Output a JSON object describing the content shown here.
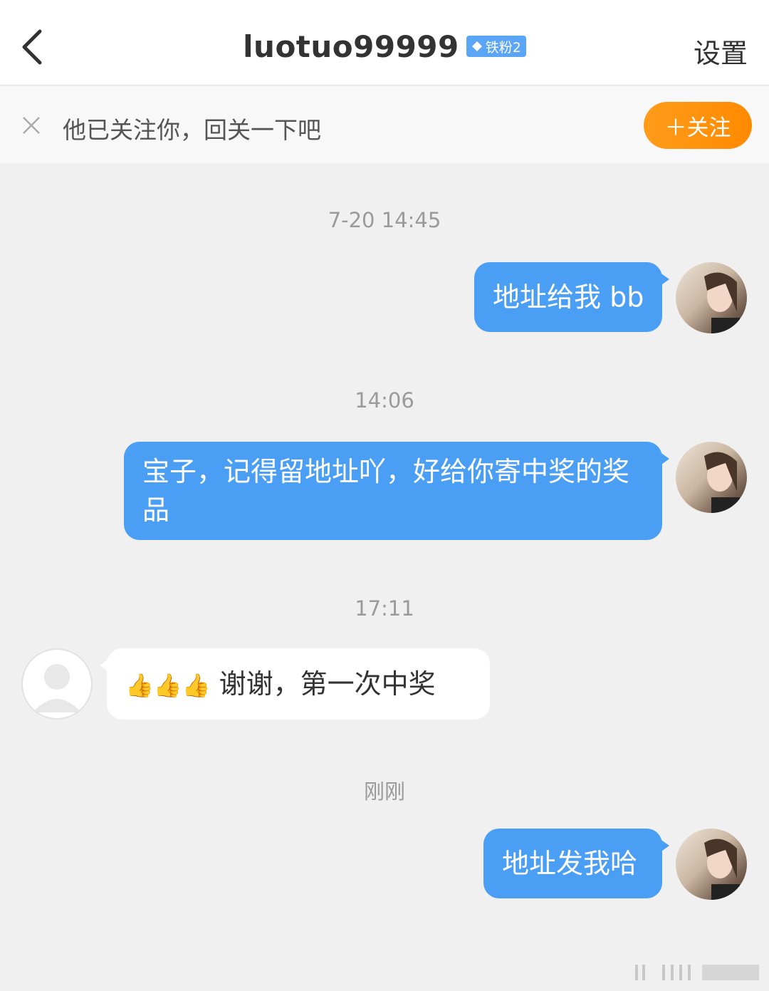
{
  "header": {
    "title": "luotuo99999",
    "badge_label": "铁粉2",
    "settings_label": "设置",
    "back_icon": "chevron-left-icon"
  },
  "follow_bar": {
    "text": "他已关注你，回关一下吧",
    "button_label": "＋关注",
    "colors": {
      "button": "#ff9200",
      "bar": "#f8f8f8"
    }
  },
  "messages": [
    {
      "time": "7-20 14:45",
      "from": "me",
      "text": "地址给我 bb"
    },
    {
      "time": "14:06",
      "from": "me",
      "text": "宝子，记得留地址吖，好给你寄中奖的奖品"
    },
    {
      "time": "17:11",
      "from": "other",
      "text": "谢谢，第一次中奖",
      "emoji": "👍👍👍"
    },
    {
      "time": "刚刚",
      "from": "me",
      "text": "地址发我哈"
    }
  ],
  "colors": {
    "bubble_out": "#4a9ff5",
    "bubble_in": "#ffffff",
    "background": "#f0f0f0"
  }
}
